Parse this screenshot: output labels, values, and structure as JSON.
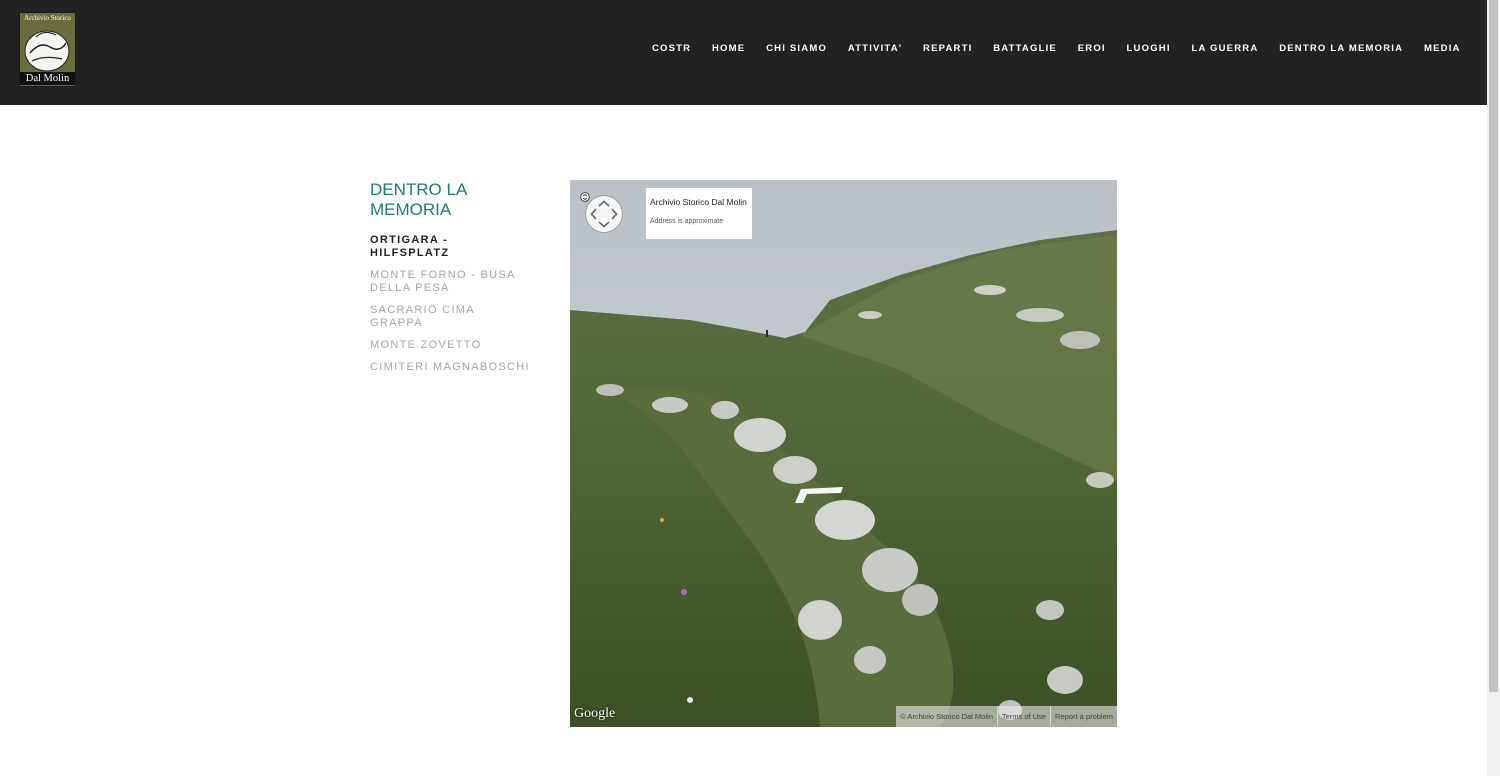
{
  "header": {
    "logo": {
      "line1": "Archivio Storico",
      "line2": "Dal Molin"
    },
    "nav": [
      {
        "label": "COSTR"
      },
      {
        "label": "HOME"
      },
      {
        "label": "CHI SIAMO"
      },
      {
        "label": "ATTIVITA'"
      },
      {
        "label": "REPARTI"
      },
      {
        "label": "BATTAGLIE"
      },
      {
        "label": "EROI"
      },
      {
        "label": "LUOGHI"
      },
      {
        "label": "LA GUERRA"
      },
      {
        "label": "DENTRO LA MEMORIA"
      },
      {
        "label": "MEDIA"
      }
    ]
  },
  "sidebar": {
    "title": "DENTRO LA MEMORIA",
    "items": [
      {
        "label": "ORTIGARA - HILFSPLATZ",
        "current": true
      },
      {
        "label": "MONTE FORNO - BUSA DELLA PESA",
        "current": false
      },
      {
        "label": "SACRARIO CIMA GRAPPA",
        "current": false
      },
      {
        "label": "MONTE ZOVETTO",
        "current": false
      },
      {
        "label": "CIMITERI MAGNABOSCHI",
        "current": false
      }
    ]
  },
  "streetview": {
    "place_title": "Archivio Storico Dal Molin",
    "address_note": "Address is approximate",
    "brand": "Google",
    "attribution": "© Archivio Storico Dal Molin",
    "terms": "Terms of Use",
    "report": "Report a problem",
    "icons": [
      "expand-icon",
      "pan-control-icon",
      "forward-arrow-icon"
    ]
  },
  "colors": {
    "header_bg": "#222222",
    "accent": "#1f7b72",
    "inactive_link": "#a4a4a4"
  }
}
